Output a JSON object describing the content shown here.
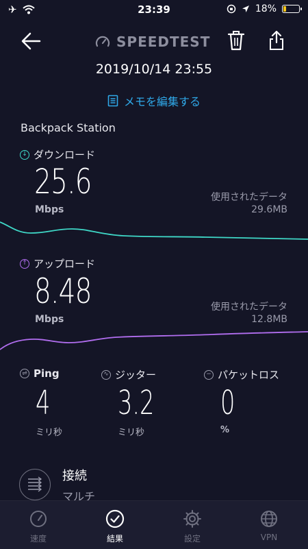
{
  "status_bar": {
    "time": "23:39",
    "battery": "18%"
  },
  "header": {
    "logo_text": "SPEEDTEST"
  },
  "result": {
    "date": "2019/10/14 23:55",
    "memo_link": "メモを編集する",
    "network_name": "Backpack Station"
  },
  "download": {
    "label": "ダウンロード",
    "value": "25.6",
    "unit": "Mbps",
    "data_used_label": "使用されたデータ",
    "data_used": "29.6MB",
    "color": "#3fd9c8"
  },
  "upload": {
    "label": "アップロード",
    "value": "8.48",
    "unit": "Mbps",
    "data_used_label": "使用されたデータ",
    "data_used": "12.8MB",
    "color": "#b26ef0"
  },
  "stats": {
    "ping": {
      "label": "Ping",
      "value": "4",
      "unit": "ミリ秒"
    },
    "jitter": {
      "label": "ジッター",
      "value": "3.2",
      "unit": "ミリ秒"
    },
    "packet_loss": {
      "label": "パケットロス",
      "value": "0",
      "unit": "%"
    }
  },
  "connection": {
    "title": "接続",
    "value": "マルチ"
  },
  "tabs": [
    {
      "label": "速度",
      "icon": "speedometer-icon"
    },
    {
      "label": "結果",
      "icon": "checkmark-icon"
    },
    {
      "label": "設定",
      "icon": "gear-icon"
    },
    {
      "label": "VPN",
      "icon": "globe-icon"
    }
  ]
}
